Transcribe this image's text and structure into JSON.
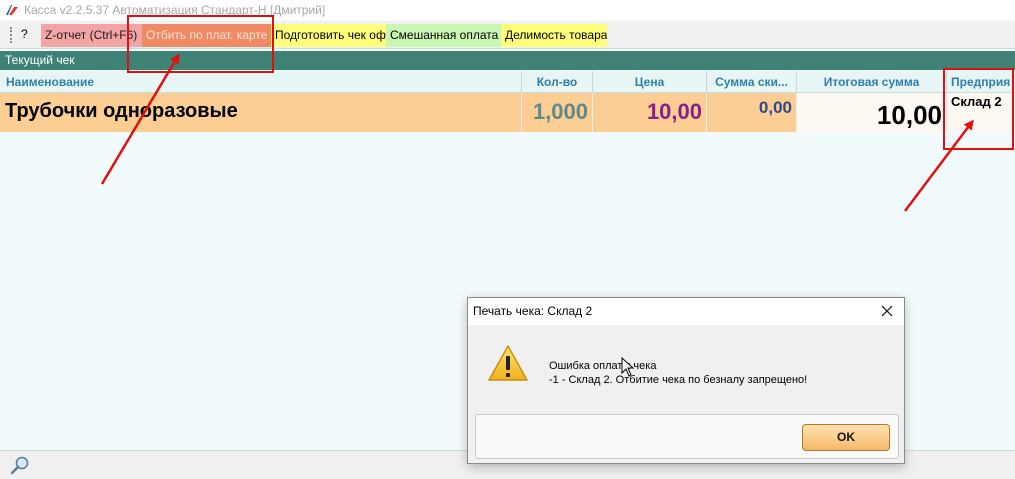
{
  "window": {
    "title": "Касса v2.2.5.37 Автоматизация Стандарт-Н [Дмитрий]"
  },
  "toolbar": {
    "grip_label": "?",
    "buttons": [
      {
        "label": "Z-отчет (Ctrl+F6)",
        "color": "#f3a4a4"
      },
      {
        "label": "Отбить по плат. карте",
        "color": "#f08a64"
      },
      {
        "label": "Подготовить чек оф",
        "color": "#fffd79"
      },
      {
        "label": "Смешанная оплата",
        "color": "#c8f7b4"
      },
      {
        "label": "Делимость товара",
        "color": "#fffd79"
      }
    ]
  },
  "current_receipt": {
    "title": "Текущий чек",
    "columns": [
      "Наименование",
      "Кол-во",
      "Цена",
      "Сумма ски...",
      "Итоговая сумма",
      "Предприя"
    ],
    "rows": [
      {
        "name": "Трубочки одноразовые",
        "qty": "1,000",
        "price": "10,00",
        "discount": "0,00",
        "total": "10,00",
        "enterprise": "Склад 2"
      }
    ]
  },
  "dialog": {
    "title": "Печать чека: Склад 2",
    "message_line1": "Ошибка оплаты чека",
    "message_line2": "-1 - Склад 2. Отбитие чека по безналу запрещено!",
    "ok_label": "OK",
    "icon": "warning-icon"
  },
  "statusbar": {
    "icon": "search-icon"
  },
  "colors": {
    "header_teal": "#3d8275",
    "row_highlight": "#fcce93",
    "annotation_red": "#e01010"
  }
}
